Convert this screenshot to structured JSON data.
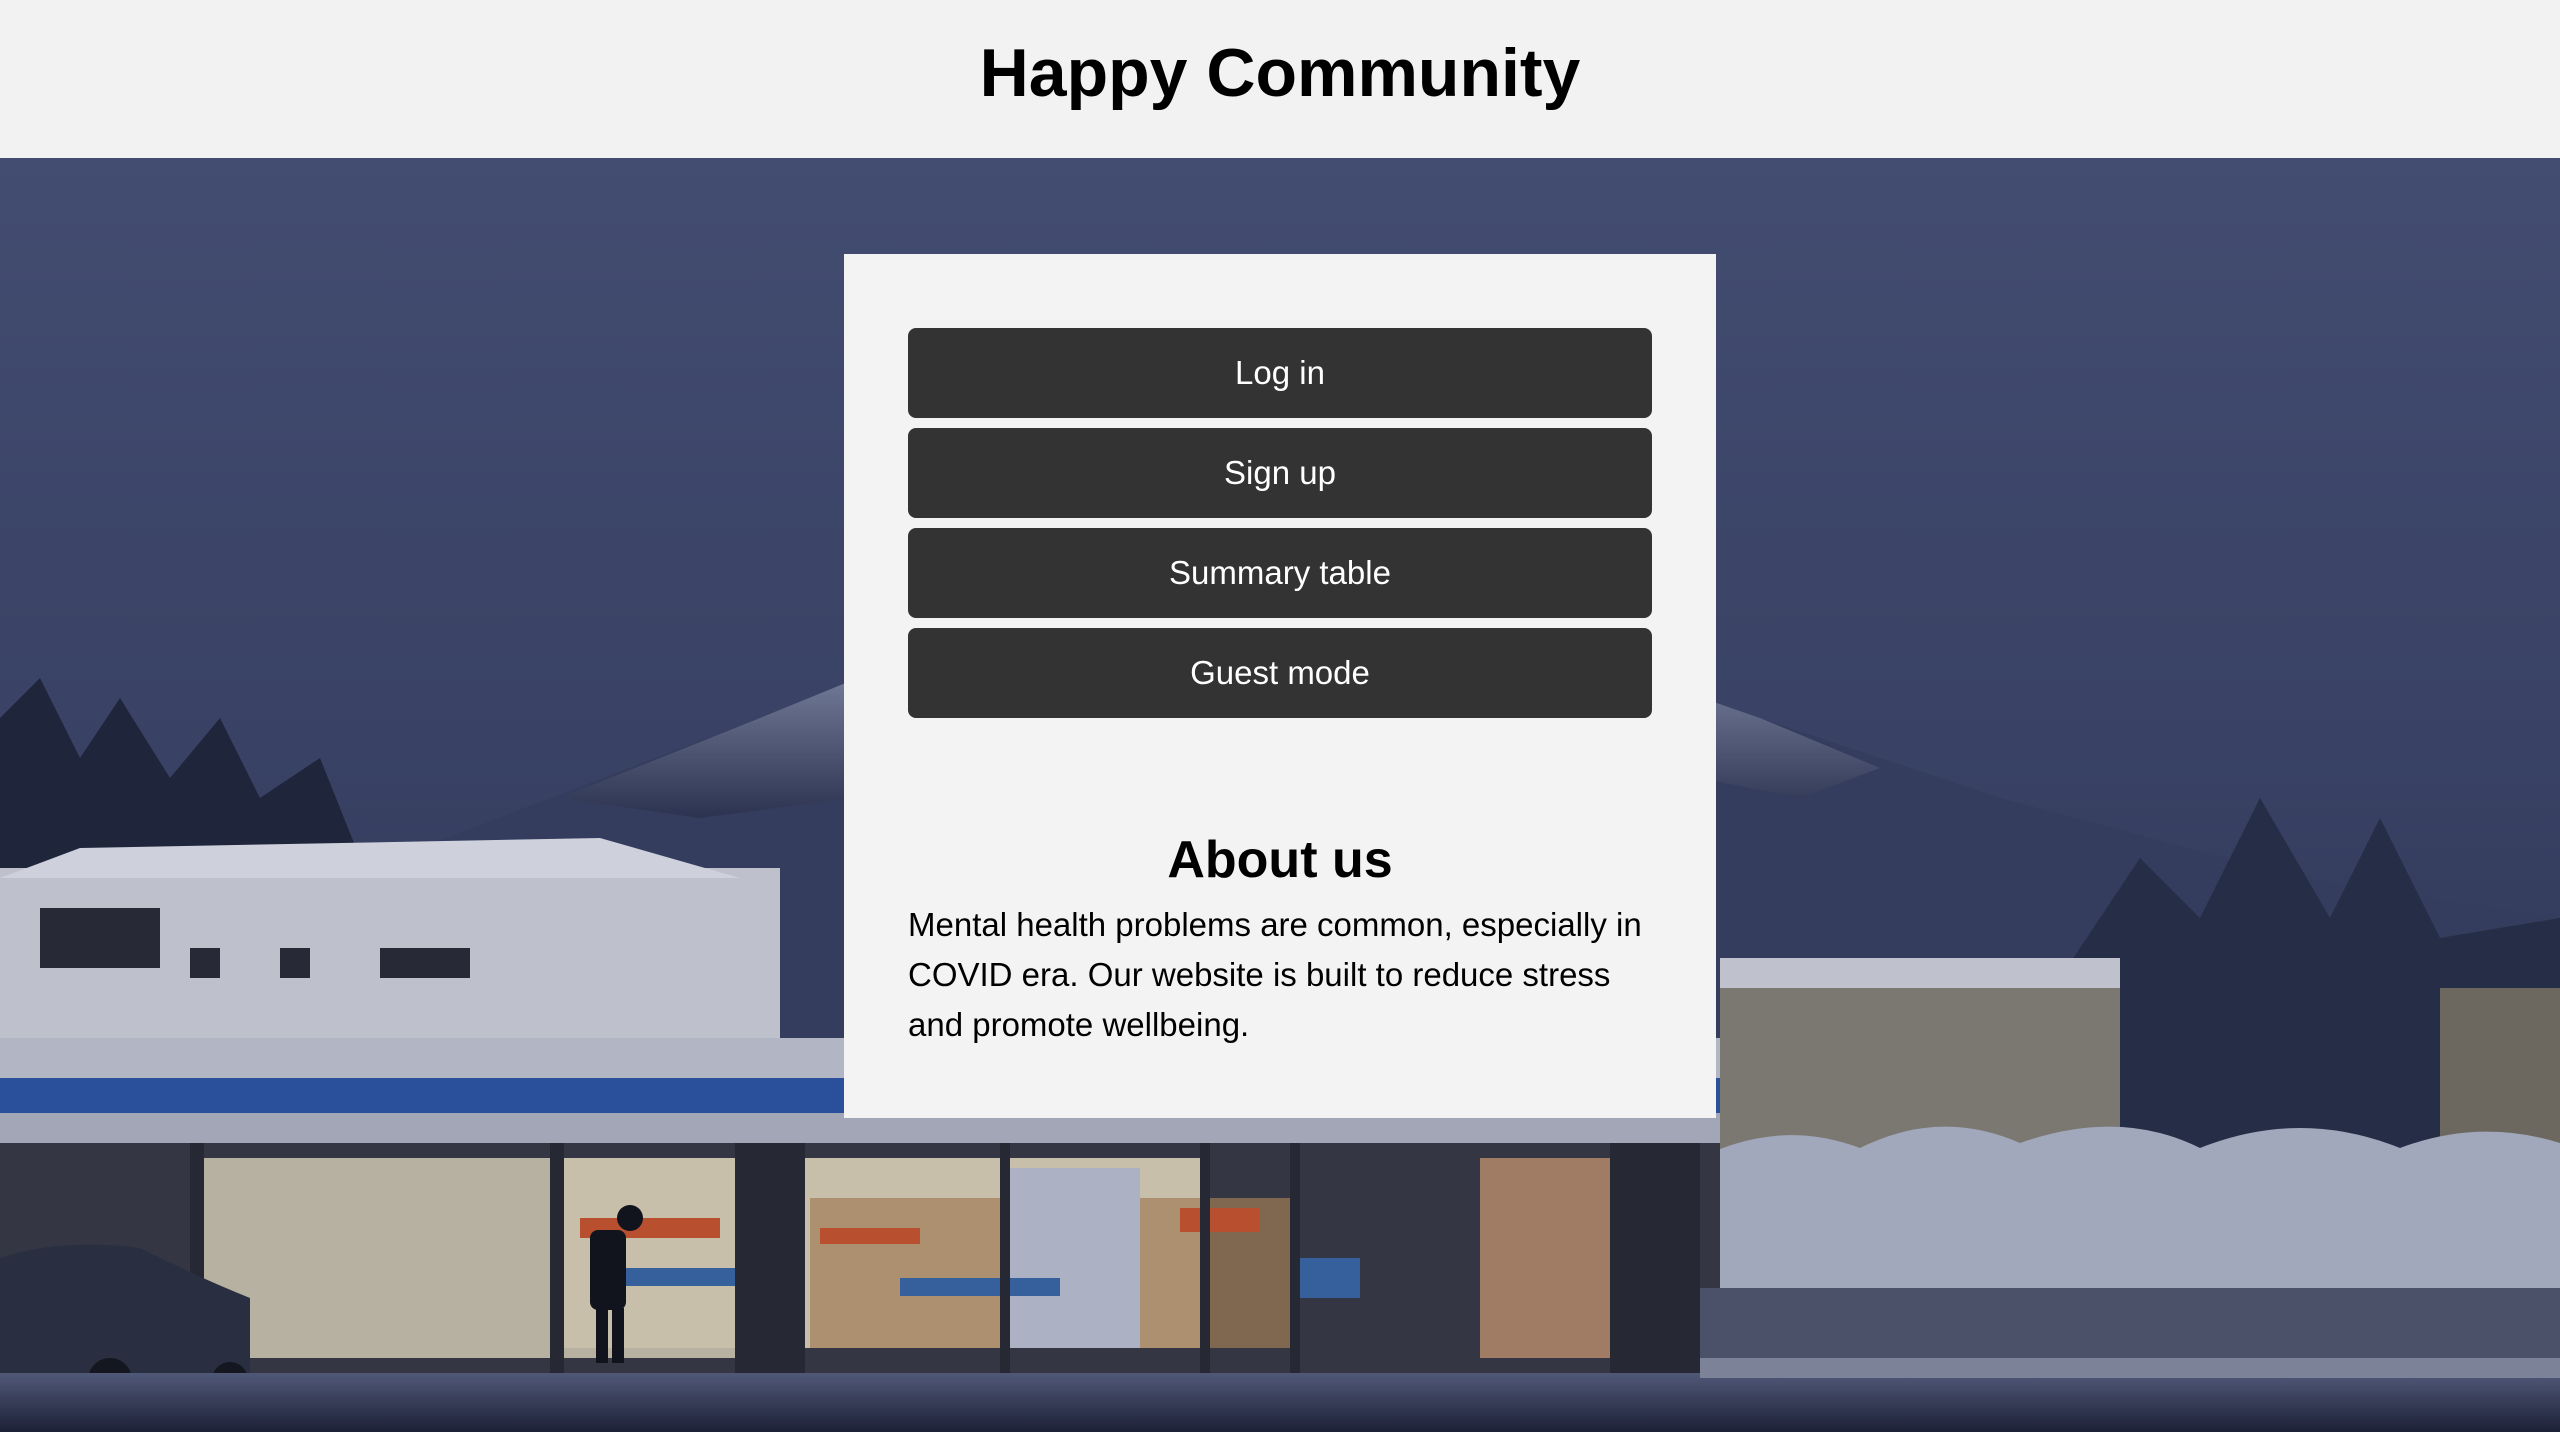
{
  "header": {
    "title": "Happy Community"
  },
  "menu": {
    "login_label": "Log in",
    "signup_label": "Sign up",
    "summary_label": "Summary table",
    "guest_label": "Guest mode"
  },
  "about": {
    "title": "About us",
    "text": "Mental health problems are common, especially in COVID era. Our website is built to reduce stress and promote wellbeing."
  },
  "colors": {
    "header_bg": "#f2f2f2",
    "card_bg": "#f3f3f3",
    "button_bg": "#333333",
    "button_text": "#ffffff",
    "sky": "#3e4666"
  },
  "background_image": "snowy-mountain-convenience-store-photo"
}
